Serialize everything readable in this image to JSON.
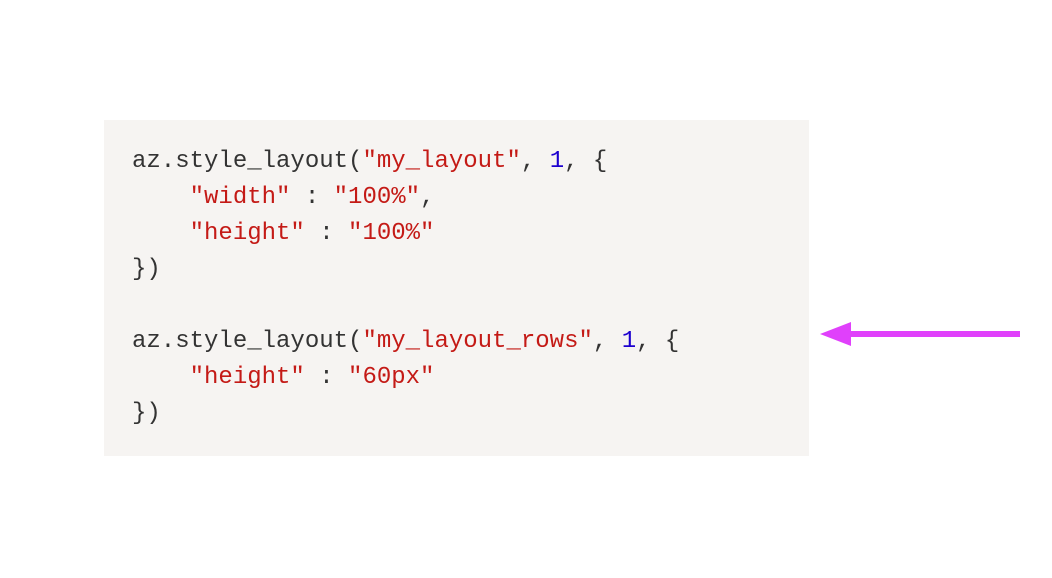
{
  "code": {
    "block1": {
      "fn_call_prefix": "az.style_layout(",
      "arg1": "\"my_layout\"",
      "sep1": ", ",
      "arg2": "1",
      "sep2": ", {",
      "prop1_key": "\"width\"",
      "prop1_sep": " : ",
      "prop1_val": "\"100%\"",
      "prop1_tail": ",",
      "prop2_key": "\"height\"",
      "prop2_sep": " : ",
      "prop2_val": "\"100%\"",
      "close": "})"
    },
    "block2": {
      "fn_call_prefix": "az.style_layout(",
      "arg1": "\"my_layout_rows\"",
      "sep1": ", ",
      "arg2": "1",
      "sep2": ", {",
      "prop1_key": "\"height\"",
      "prop1_sep": " : ",
      "prop1_val": "\"60px\"",
      "close": "})"
    },
    "indent": "    "
  },
  "annotation": {
    "arrow_color": "#e040fb"
  }
}
